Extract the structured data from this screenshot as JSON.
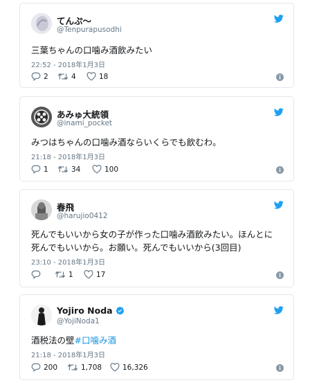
{
  "tweets": [
    {
      "name": "てんぷ〜",
      "handle": "@Tenpurapusodhi",
      "text_lines": [
        "三葉ちゃんの口噛み酒飲みたい"
      ],
      "timestamp": "22:52 - 2018年1月3日",
      "replies": "2",
      "retweets": "4",
      "likes": "18",
      "verified": false
    },
    {
      "name": "あみゅ大統領",
      "handle": "@inami_pocket",
      "text_lines": [
        "みつはちゃんの口噛み酒ならいくらでも飲むわ。"
      ],
      "timestamp": "21:18 - 2018年1月3日",
      "replies": "1",
      "retweets": "34",
      "likes": "100",
      "verified": false
    },
    {
      "name": "春飛",
      "handle": "@harujio0412",
      "text_lines": [
        "死んでもいいから女の子が作った口噛み酒飲みたい。ほんとに",
        "死んでもいいから。お願い。死んでもいいから(3回目)"
      ],
      "timestamp": "23:10 - 2018年1月3日",
      "replies": "",
      "retweets": "1",
      "likes": "17",
      "verified": false
    },
    {
      "name": "Yojiro Noda",
      "handle": "@YojiNoda1",
      "text_prefix": "酒税法の壁",
      "text_hashtag": "#口噛み酒",
      "timestamp": "21:18 - 2018年1月3日",
      "replies": "200",
      "retweets": "1,708",
      "likes": "16,326",
      "verified": true
    }
  ],
  "icons": {
    "brand": "twitter-bird-icon",
    "reply": "reply-icon",
    "retweet": "retweet-icon",
    "like": "heart-icon",
    "info": "info-icon",
    "verified": "verified-badge-icon"
  },
  "colors": {
    "twitter_blue": "#1da1f2",
    "hashtag": "#1b95e0",
    "border": "#e1e8ed",
    "muted": "#657786"
  }
}
